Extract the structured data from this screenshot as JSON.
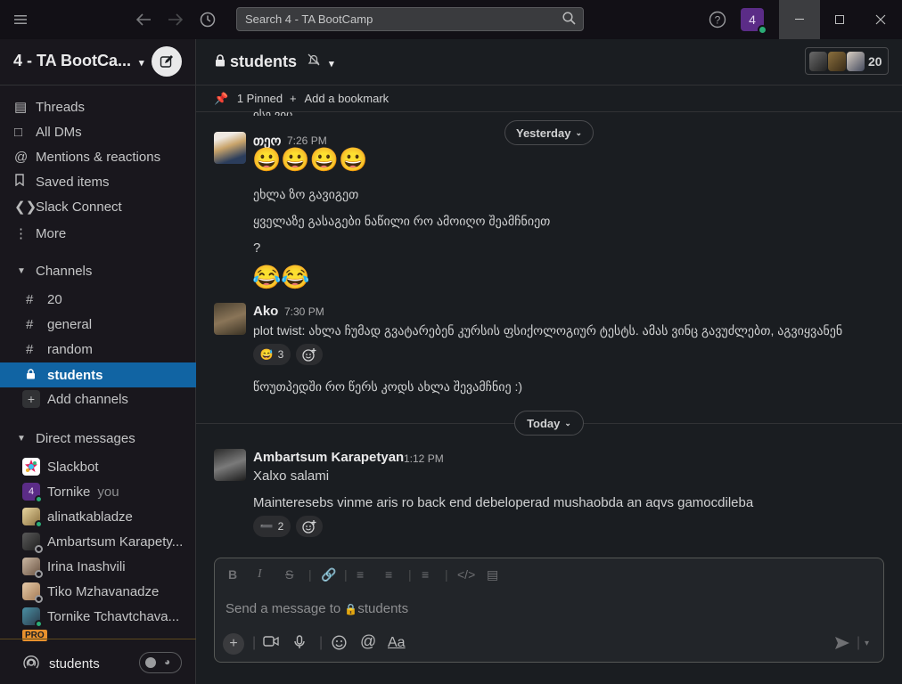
{
  "search": {
    "placeholder": "Search 4 - TA BootCamp"
  },
  "workspace": {
    "name": "4 - TA BootCa...",
    "badge": "4"
  },
  "nav": [
    {
      "label": "Threads",
      "icon": "threads-icon"
    },
    {
      "label": "All DMs",
      "icon": "dms-icon"
    },
    {
      "label": "Mentions & reactions",
      "icon": "mention-icon"
    },
    {
      "label": "Saved items",
      "icon": "bookmark-icon"
    },
    {
      "label": "Slack Connect",
      "icon": "slack-connect-icon"
    },
    {
      "label": "More",
      "icon": "more-icon"
    }
  ],
  "channels": {
    "header": "Channels",
    "items": [
      {
        "name": "20",
        "active": false
      },
      {
        "name": "general",
        "active": false
      },
      {
        "name": "random",
        "active": false
      },
      {
        "name": "students",
        "active": true
      }
    ],
    "add_label": "Add channels"
  },
  "dms": {
    "header": "Direct messages",
    "items": [
      {
        "name": "Slackbot",
        "suffix": ""
      },
      {
        "name": "Tornike",
        "suffix": "you"
      },
      {
        "name": "alinatkabladze",
        "suffix": ""
      },
      {
        "name": "Ambartsum Karapety...",
        "suffix": ""
      },
      {
        "name": "Irina Inashvili",
        "suffix": ""
      },
      {
        "name": "Tiko Mzhavanadze",
        "suffix": ""
      },
      {
        "name": "Tornike Tchavtchava...",
        "suffix": ""
      }
    ],
    "pro_badge": "PRO"
  },
  "huddle": {
    "label": "students"
  },
  "channel": {
    "name": "students",
    "member_count": "20",
    "pinned": "1 Pinned",
    "add_bookmark": "Add a bookmark"
  },
  "messages": {
    "cut_text": "ისე ვიც",
    "yesterday_label": "Yesterday",
    "today_label": "Today",
    "m1": {
      "author": "თეო",
      "time": "7:26 PM",
      "emoji_row": "😀😀😀😀",
      "line1": "ეხლა ზო გავიგეთ",
      "line2": "ყველაზე გასაგები ნაწილი რო ამოიღო შეამჩნიეთ",
      "line3": "?",
      "emoji_row2": "😂😂"
    },
    "m2": {
      "author": "Ako",
      "time": "7:30 PM",
      "line1": "plot twist: ახლა ჩუმად გვატარებენ კურსის ფსიქოლოგიურ ტესტს. ამას ვინც გავუძლებთ, აგვიყვანენ",
      "reaction_emoji": "😅",
      "reaction_count": "3",
      "line2": "წოუთპედში რო წერს კოდს ახლა შევამჩნიე :)"
    },
    "m3": {
      "author": "Ambartsum Karapetyan",
      "time": "1:12 PM",
      "line1": "Xalxo salami",
      "line2": "Mainteresebs vinme aris ro back end debeloperad mushaobda an aqvs gamocdileba",
      "reaction_emoji": "➖",
      "reaction_count": "2"
    }
  },
  "composer": {
    "placeholder_prefix": "Send a message to ",
    "placeholder_channel": "students",
    "aa_label": "Aa"
  },
  "colors": {
    "accent": "#1164a3",
    "bg": "#1a1d21",
    "sidebar": "#19171d",
    "online": "#2bac76"
  }
}
